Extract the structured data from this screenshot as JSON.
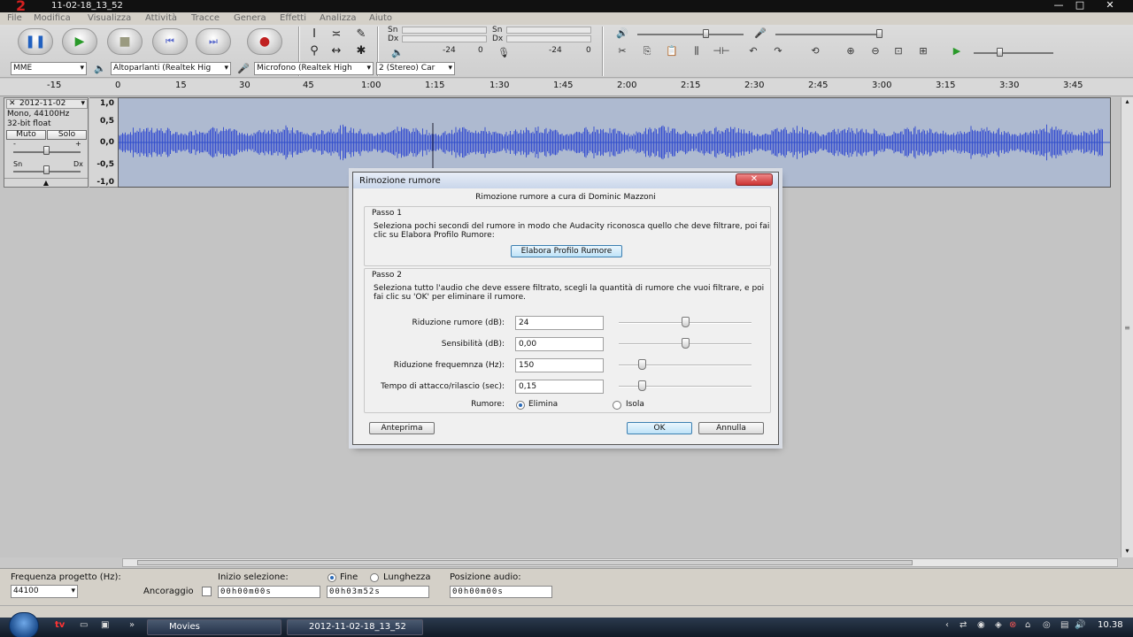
{
  "window": {
    "logo": "2",
    "title": "11-02-18_13_52",
    "minimize": "—",
    "maximize": "□",
    "close": "✕"
  },
  "menu": [
    "File",
    "Modifica",
    "Visualizza",
    "Attività",
    "Tracce",
    "Genera",
    "Effetti",
    "Analizza",
    "Aiuto"
  ],
  "meters": {
    "play_top": "Sn",
    "play_bottom": "Dx",
    "play_db": "-24",
    "play_zero": "0",
    "rec_top": "Sn",
    "rec_bottom": "Dx",
    "rec_db": "-24",
    "rec_zero": "0"
  },
  "devices": {
    "host": "MME",
    "output": "Altoparlanti (Realtek Hig",
    "input": "Microfono (Realtek High",
    "channels": "2 (Stereo) Car"
  },
  "ruler": [
    "-15",
    "0",
    "15",
    "30",
    "45",
    "1:00",
    "1:15",
    "1:30",
    "1:45",
    "2:00",
    "2:15",
    "2:30",
    "2:45",
    "3:00",
    "3:15",
    "3:30",
    "3:45"
  ],
  "track": {
    "name": "2012-11-02",
    "info1": "Mono, 44100Hz",
    "info2": "32-bit float",
    "mute": "Muto",
    "solo": "Solo",
    "gain_minus": "-",
    "gain_plus": "+",
    "pan_left": "Sn",
    "pan_right": "Dx",
    "yaxis": [
      "1,0",
      "0,5",
      "0,0",
      "-0,5",
      "-1,0"
    ]
  },
  "dialog": {
    "title": "Rimozione rumore",
    "close": "✕",
    "credit": "Rimozione rumore a cura di Dominic Mazzoni",
    "step1_title": "Passo 1",
    "step1_text": "Seleziona pochi secondi del rumore in modo che Audacity riconosca quello che deve filtrare, poi fai clic su Elabora Profilo Rumore:",
    "profile_button": "Elabora Profilo Rumore",
    "step2_title": "Passo 2",
    "step2_text": "Seleziona tutto l'audio che deve essere filtrato, scegli la quantità di rumore che vuoi filtrare, e poi fai clic su 'OK' per eliminare il rumore.",
    "params": [
      {
        "label": "Riduzione rumore (dB):",
        "value": "24",
        "slider": 0.5
      },
      {
        "label": "Sensibilità (dB):",
        "value": "0,00",
        "slider": 0.5
      },
      {
        "label": "Riduzione frequemnza (Hz):",
        "value": "150",
        "slider": 0.17
      },
      {
        "label": "Tempo di attacco/rilascio (sec):",
        "value": "0,15",
        "slider": 0.17
      }
    ],
    "noise_label": "Rumore:",
    "option_remove": "Elimina",
    "option_isolate": "Isola",
    "preview": "Anteprima",
    "ok": "OK",
    "cancel": "Annulla"
  },
  "selection": {
    "rate_label": "Frequenza progetto (Hz):",
    "rate_value": "44100",
    "snap_label": "Ancoraggio",
    "start_label": "Inizio selezione:",
    "start_value": "00h00m00s",
    "end_label": "Fine",
    "length_label": "Lunghezza",
    "end_value": "00h03m52s",
    "pos_label": "Posizione audio:",
    "pos_value": "00h00m00s"
  },
  "taskbar": {
    "task1": "Movies",
    "task2": "2012-11-02-18_13_52",
    "clock": "10.38"
  }
}
